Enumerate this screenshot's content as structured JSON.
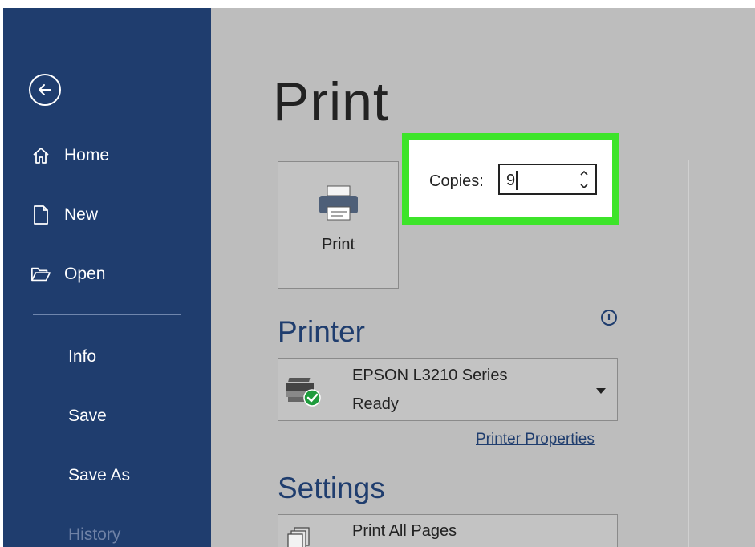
{
  "sidebar": {
    "items": [
      {
        "label": "Home",
        "icon": "home-icon"
      },
      {
        "label": "New",
        "icon": "new-document-icon"
      },
      {
        "label": "Open",
        "icon": "open-folder-icon"
      }
    ],
    "secondary": [
      "Info",
      "Save",
      "Save As",
      "History"
    ]
  },
  "main": {
    "title": "Print",
    "print_button": {
      "label": "Print",
      "icon": "printer-icon"
    },
    "copies": {
      "label": "Copies:",
      "value": "9"
    },
    "printer": {
      "heading": "Printer",
      "name": "EPSON L3210 Series",
      "status": "Ready",
      "properties_link": "Printer Properties"
    },
    "settings": {
      "heading": "Settings",
      "selected": "Print All Pages"
    }
  },
  "colors": {
    "sidebar_bg": "#1f3d6e",
    "main_bg": "#bdbdbd",
    "highlight": "#3de42a",
    "accent_text": "#1f3d6e",
    "ready_green": "#1e9b3c"
  }
}
